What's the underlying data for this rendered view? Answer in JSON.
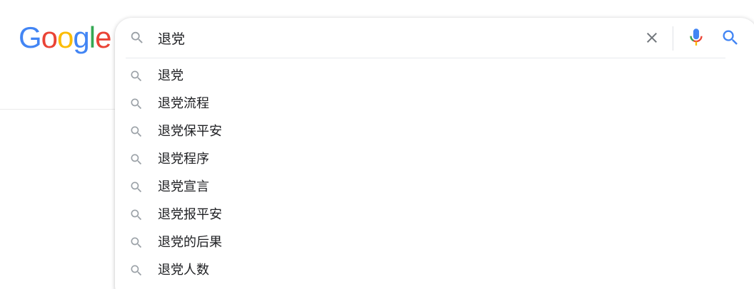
{
  "logo": {
    "letters": [
      {
        "char": "G",
        "color": "#4285F4"
      },
      {
        "char": "o",
        "color": "#EA4335"
      },
      {
        "char": "o",
        "color": "#FBBC05"
      },
      {
        "char": "g",
        "color": "#4285F4"
      },
      {
        "char": "l",
        "color": "#34A853"
      },
      {
        "char": "e",
        "color": "#EA4335"
      }
    ]
  },
  "search": {
    "value": "退党",
    "search_icon": "search-icon",
    "clear_icon": "close-icon",
    "mic_icon": "microphone-icon",
    "submit_icon": "search-icon",
    "submit_color": "#4285F4",
    "icon_gray": "#70757a"
  },
  "suggestions": [
    {
      "text": "退党",
      "icon": "search-icon"
    },
    {
      "text": "退党流程",
      "icon": "search-icon"
    },
    {
      "text": "退党保平安",
      "icon": "search-icon"
    },
    {
      "text": "退党程序",
      "icon": "search-icon"
    },
    {
      "text": "退党宣言",
      "icon": "search-icon"
    },
    {
      "text": "退党报平安",
      "icon": "search-icon"
    },
    {
      "text": "退党的后果",
      "icon": "search-icon"
    },
    {
      "text": "退党人数",
      "icon": "search-icon"
    }
  ]
}
